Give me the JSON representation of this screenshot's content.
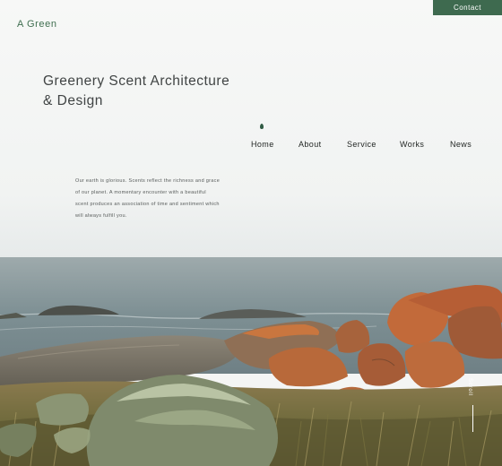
{
  "header": {
    "logo": "A Green",
    "contact_label": "Contact"
  },
  "hero": {
    "headline_line1": "Greenery Scent Architecture",
    "headline_line2": "& Design",
    "intro_lines": [
      "Our earth is glorious. Scents reflect the richness and grace",
      "of our planet. A momentary encounter with a beautiful",
      "scent produces an association of time and sentiment which",
      "will always fulfill you."
    ],
    "scroll_label": "Scroll"
  },
  "nav": {
    "items": [
      {
        "label": "Home"
      },
      {
        "label": "About"
      },
      {
        "label": "Service"
      },
      {
        "label": "Works"
      },
      {
        "label": "News"
      }
    ],
    "active_index": 0
  },
  "colors": {
    "brand_green": "#3e6a4f",
    "sky": "#f4f5f4",
    "sea": "#7f9195",
    "lichen_orange": "#c26a3a"
  },
  "icons": {
    "nav_indicator": "drop-indicator-icon"
  }
}
